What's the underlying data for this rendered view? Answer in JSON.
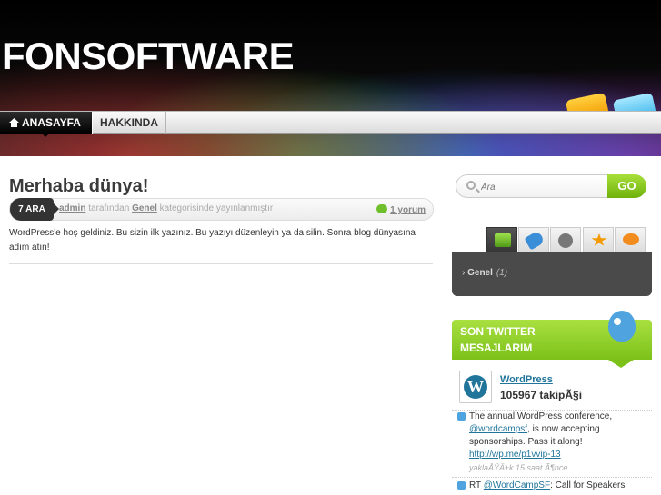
{
  "site": {
    "title": "FONSOFTWARE"
  },
  "nav": {
    "home": "ANASAYFA",
    "about": "HAKKINDA"
  },
  "post": {
    "title": "Merhaba dünya!",
    "date": "7 ARA",
    "author": "admin",
    "by_text": "tarafından",
    "category": "Genel",
    "category_text": "kategorisinde yayınlanmıştır",
    "comments": "1 yorum",
    "body": "WordPress'e hoş geldiniz. Bu sizin ilk yazınız. Bu yazıyı düzenleyin ya da silin. Sonra blog dünyasına adım atın!"
  },
  "search": {
    "placeholder": "Ara",
    "button": "GO"
  },
  "sidebar": {
    "tabs": [
      {
        "icon": "folder-icon"
      },
      {
        "icon": "tag-icon"
      },
      {
        "icon": "clock-icon"
      },
      {
        "icon": "star-icon"
      },
      {
        "icon": "comment-bubble-icon"
      }
    ],
    "category": {
      "name": "Genel",
      "count": "(1)"
    }
  },
  "twitter": {
    "title": "SON TWITTER MESAJLARIM",
    "user": "WordPress",
    "followers": "105967 takipÃ§i",
    "tweets": [
      {
        "pre": "The annual WordPress conference,",
        "mention": "@wordcampsf",
        "post": ", is now accepting sponsorships. Pass it along!",
        "link": "http://wp.me/p1vvip-13",
        "time": "yaklaÅŸÄ±k 15 saat Ã¶nce"
      },
      {
        "pre": "RT",
        "mention": "@WordCampSF",
        "post": ": Call for Speakers"
      }
    ]
  },
  "colors": {
    "accent_green": "#7cc11a",
    "link_blue": "#21759b",
    "nav_active": "#000000"
  }
}
